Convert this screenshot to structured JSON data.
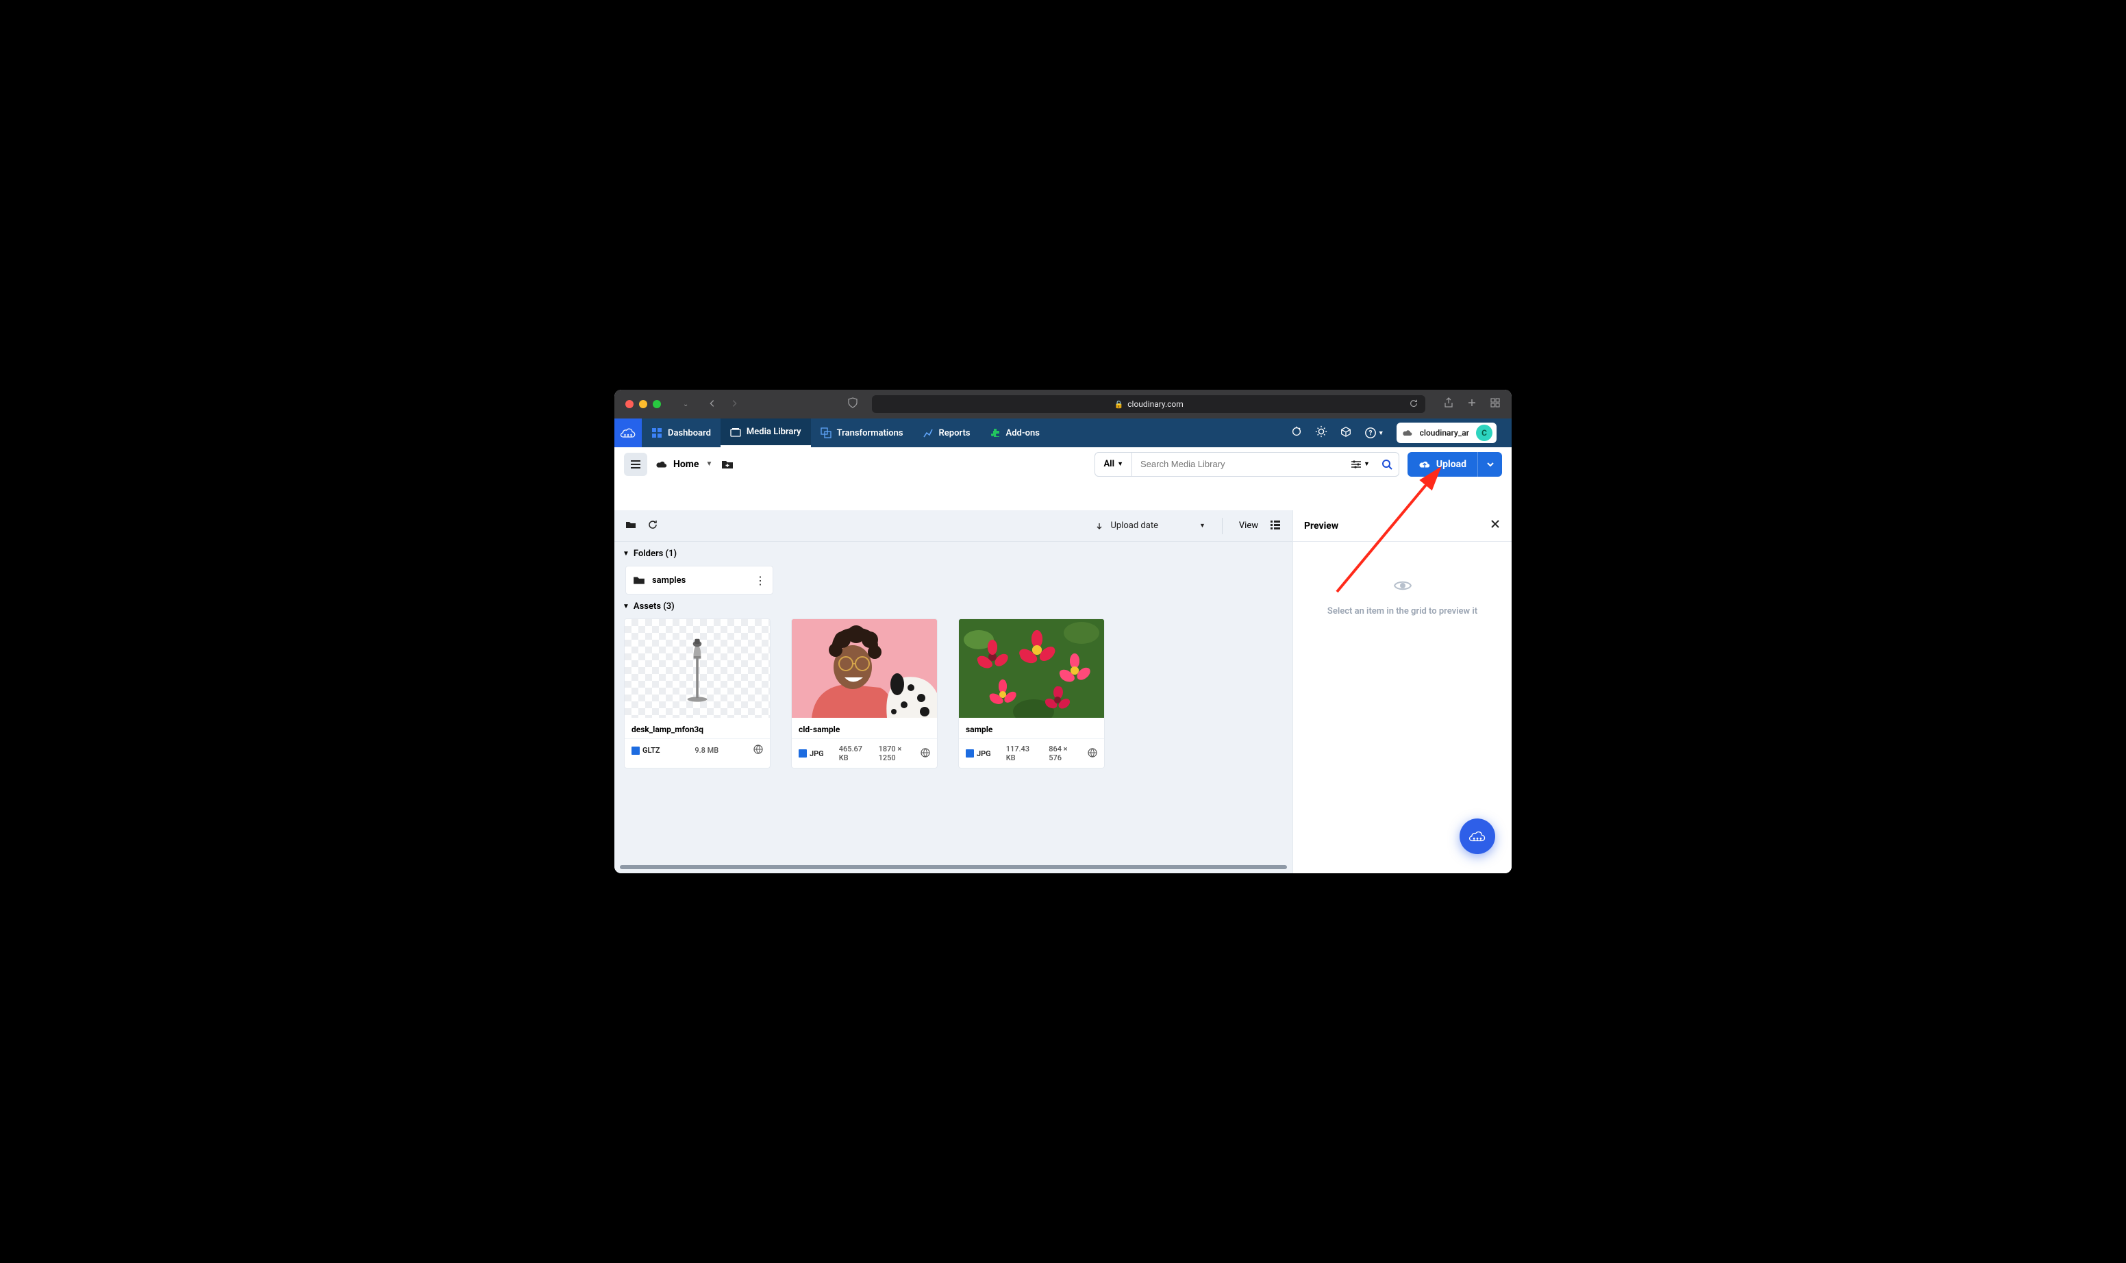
{
  "browser": {
    "url_host": "cloudinary.com"
  },
  "topnav": {
    "dashboard": "Dashboard",
    "media_library": "Media Library",
    "transformations": "Transformations",
    "reports": "Reports",
    "addons": "Add-ons"
  },
  "account": {
    "name": "cloudinary_ar",
    "avatar_initial": "C"
  },
  "toolbar": {
    "home": "Home",
    "search_all": "All",
    "search_placeholder": "Search Media Library",
    "upload": "Upload"
  },
  "maintb": {
    "sort_label": "Upload date",
    "view_label": "View"
  },
  "sections": {
    "folders_label": "Folders (1)",
    "assets_label": "Assets (3)"
  },
  "folders": [
    {
      "name": "samples"
    }
  ],
  "assets": [
    {
      "name": "desk_lamp_mfon3q",
      "format": "GLTZ",
      "size": "9.8 MB",
      "dims": ""
    },
    {
      "name": "cld-sample",
      "format": "JPG",
      "size": "465.67 KB",
      "dims": "1870 × 1250"
    },
    {
      "name": "sample",
      "format": "JPG",
      "size": "117.43 KB",
      "dims": "864 × 576"
    }
  ],
  "preview": {
    "title": "Preview",
    "empty_msg": "Select an item in the grid to preview it"
  }
}
